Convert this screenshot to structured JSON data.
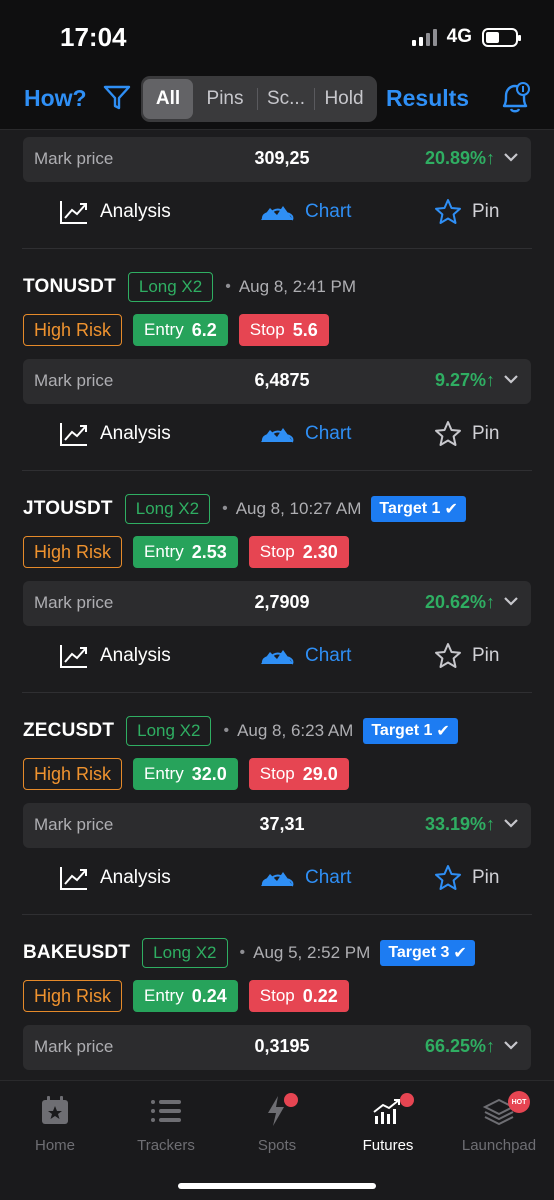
{
  "status_bar": {
    "time": "17:04",
    "network": "4G"
  },
  "toolbar": {
    "how_label": "How?",
    "segments": [
      "All",
      "Pins",
      "Sc...",
      "Hold"
    ],
    "active_segment": "All",
    "results_label": "Results"
  },
  "colors": {
    "accent": "#2f8ff5",
    "green": "#2fae62",
    "red": "#e64552",
    "orange": "#f0932f",
    "target": "#1d7cf2"
  },
  "partial_card": {
    "mark_label": "Mark price",
    "mark_value": "309,25",
    "change": "20.89%↑",
    "analysis": "Analysis",
    "chart": "Chart",
    "pin": "Pin",
    "pinned": true
  },
  "signals": [
    {
      "pair": "TONUSDT",
      "leverage": "Long X2",
      "date": "Aug 8, 2:41 PM",
      "target": "",
      "risk": "High Risk",
      "entry_label": "Entry",
      "entry": "6.2",
      "stop_label": "Stop",
      "stop": "5.6",
      "mark_label": "Mark price",
      "mark_value": "6,4875",
      "change": "9.27%↑",
      "analysis": "Analysis",
      "chart": "Chart",
      "pin": "Pin",
      "pinned": false
    },
    {
      "pair": "JTOUSDT",
      "leverage": "Long X2",
      "date": "Aug 8, 10:27 AM",
      "target": "Target 1",
      "risk": "High Risk",
      "entry_label": "Entry",
      "entry": "2.53",
      "stop_label": "Stop",
      "stop": "2.30",
      "mark_label": "Mark price",
      "mark_value": "2,7909",
      "change": "20.62%↑",
      "analysis": "Analysis",
      "chart": "Chart",
      "pin": "Pin",
      "pinned": false
    },
    {
      "pair": "ZECUSDT",
      "leverage": "Long X2",
      "date": "Aug 8, 6:23 AM",
      "target": "Target 1",
      "risk": "High Risk",
      "entry_label": "Entry",
      "entry": "32.0",
      "stop_label": "Stop",
      "stop": "29.0",
      "mark_label": "Mark price",
      "mark_value": "37,31",
      "change": "33.19%↑",
      "analysis": "Analysis",
      "chart": "Chart",
      "pin": "Pin",
      "pinned": true
    },
    {
      "pair": "BAKEUSDT",
      "leverage": "Long X2",
      "date": "Aug 5, 2:52 PM",
      "target": "Target 3",
      "risk": "High Risk",
      "entry_label": "Entry",
      "entry": "0.24",
      "stop_label": "Stop",
      "stop": "0.22",
      "mark_label": "Mark price",
      "mark_value": "0,3195",
      "change": "66.25%↑"
    }
  ],
  "tabbar": {
    "items": [
      {
        "label": "Home",
        "icon": "calendar-star-icon"
      },
      {
        "label": "Trackers",
        "icon": "list-icon"
      },
      {
        "label": "Spots",
        "icon": "bolt-icon"
      },
      {
        "label": "Futures",
        "icon": "futures-chart-icon"
      },
      {
        "label": "Launchpad",
        "icon": "launchpad-stack-icon"
      }
    ],
    "active": "Futures",
    "launchpad_badge": "HOT"
  }
}
